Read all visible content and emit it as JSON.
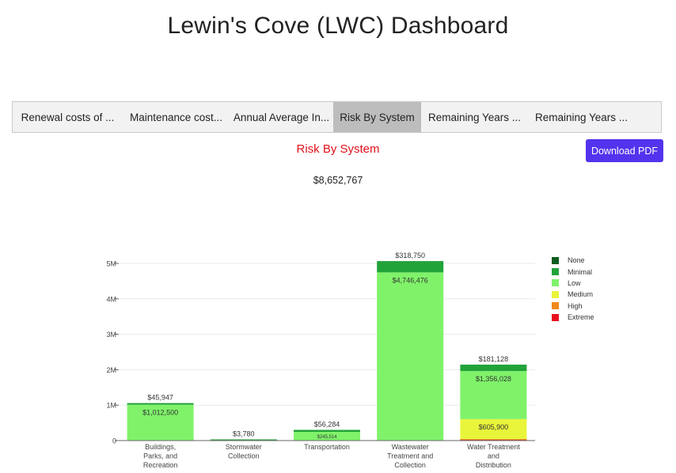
{
  "page": {
    "title": "Lewin's Cove (LWC) Dashboard"
  },
  "tabs": [
    {
      "label": "Renewal costs of ...",
      "active": false
    },
    {
      "label": "Maintenance cost...",
      "active": false
    },
    {
      "label": "Annual Average In...",
      "active": false
    },
    {
      "label": "Risk By System",
      "active": true
    },
    {
      "label": "Remaining Years ...",
      "active": false
    },
    {
      "label": "Remaining Years ...",
      "active": false
    }
  ],
  "chart_header": {
    "title": "Risk By System",
    "download_label": "Download PDF",
    "grand_total": "$8,652,767"
  },
  "chart_data": {
    "type": "bar",
    "stacked": true,
    "categories": [
      [
        "Buildings,",
        "Parks, and",
        "Recreation"
      ],
      [
        "Stormwater",
        "Collection"
      ],
      [
        "Transportation"
      ],
      [
        "Wastewater",
        "Treatment and",
        "Collection"
      ],
      [
        "Water Treatment",
        "and",
        "Distribution"
      ]
    ],
    "ylim": [
      0,
      5300000
    ],
    "y_ticks": [
      {
        "value": 0,
        "label": "0"
      },
      {
        "value": 1000000,
        "label": "1M"
      },
      {
        "value": 2000000,
        "label": "2M"
      },
      {
        "value": 3000000,
        "label": "3M"
      },
      {
        "value": 4000000,
        "label": "4M"
      },
      {
        "value": 5000000,
        "label": "5M"
      }
    ],
    "grid": true,
    "legend_position": "right",
    "series": [
      {
        "name": "None",
        "color": "#0a5c1e",
        "values": [
          0,
          0,
          0,
          0,
          0
        ],
        "labels": [
          "",
          "",
          "",
          "",
          ""
        ]
      },
      {
        "name": "Minimal",
        "color": "#22a33a",
        "values": [
          45947,
          3780,
          56284,
          318750,
          181128
        ],
        "labels": [
          "$45,947",
          "$3,780",
          "$56,284",
          "$318,750",
          "$181,128"
        ]
      },
      {
        "name": "Low",
        "color": "#80f26a",
        "values": [
          1012500,
          0,
          245514,
          4746476,
          1356028
        ],
        "labels": [
          "$1,012,500",
          "",
          "$245,514",
          "$4,746,476",
          "$1,356,028"
        ]
      },
      {
        "name": "Medium",
        "color": "#e9f53a",
        "values": [
          0,
          0,
          0,
          0,
          605900
        ],
        "labels": [
          "",
          "",
          "",
          "",
          "$605,900"
        ]
      },
      {
        "name": "High",
        "color": "#f0891a",
        "values": [
          0,
          0,
          0,
          0,
          0
        ],
        "labels": [
          "",
          "",
          "",
          "",
          ""
        ]
      },
      {
        "name": "Extreme",
        "color": "#e8101c",
        "values": [
          0,
          0,
          0,
          0,
          0
        ],
        "labels": [
          "",
          "",
          "",
          "",
          ""
        ]
      }
    ]
  }
}
